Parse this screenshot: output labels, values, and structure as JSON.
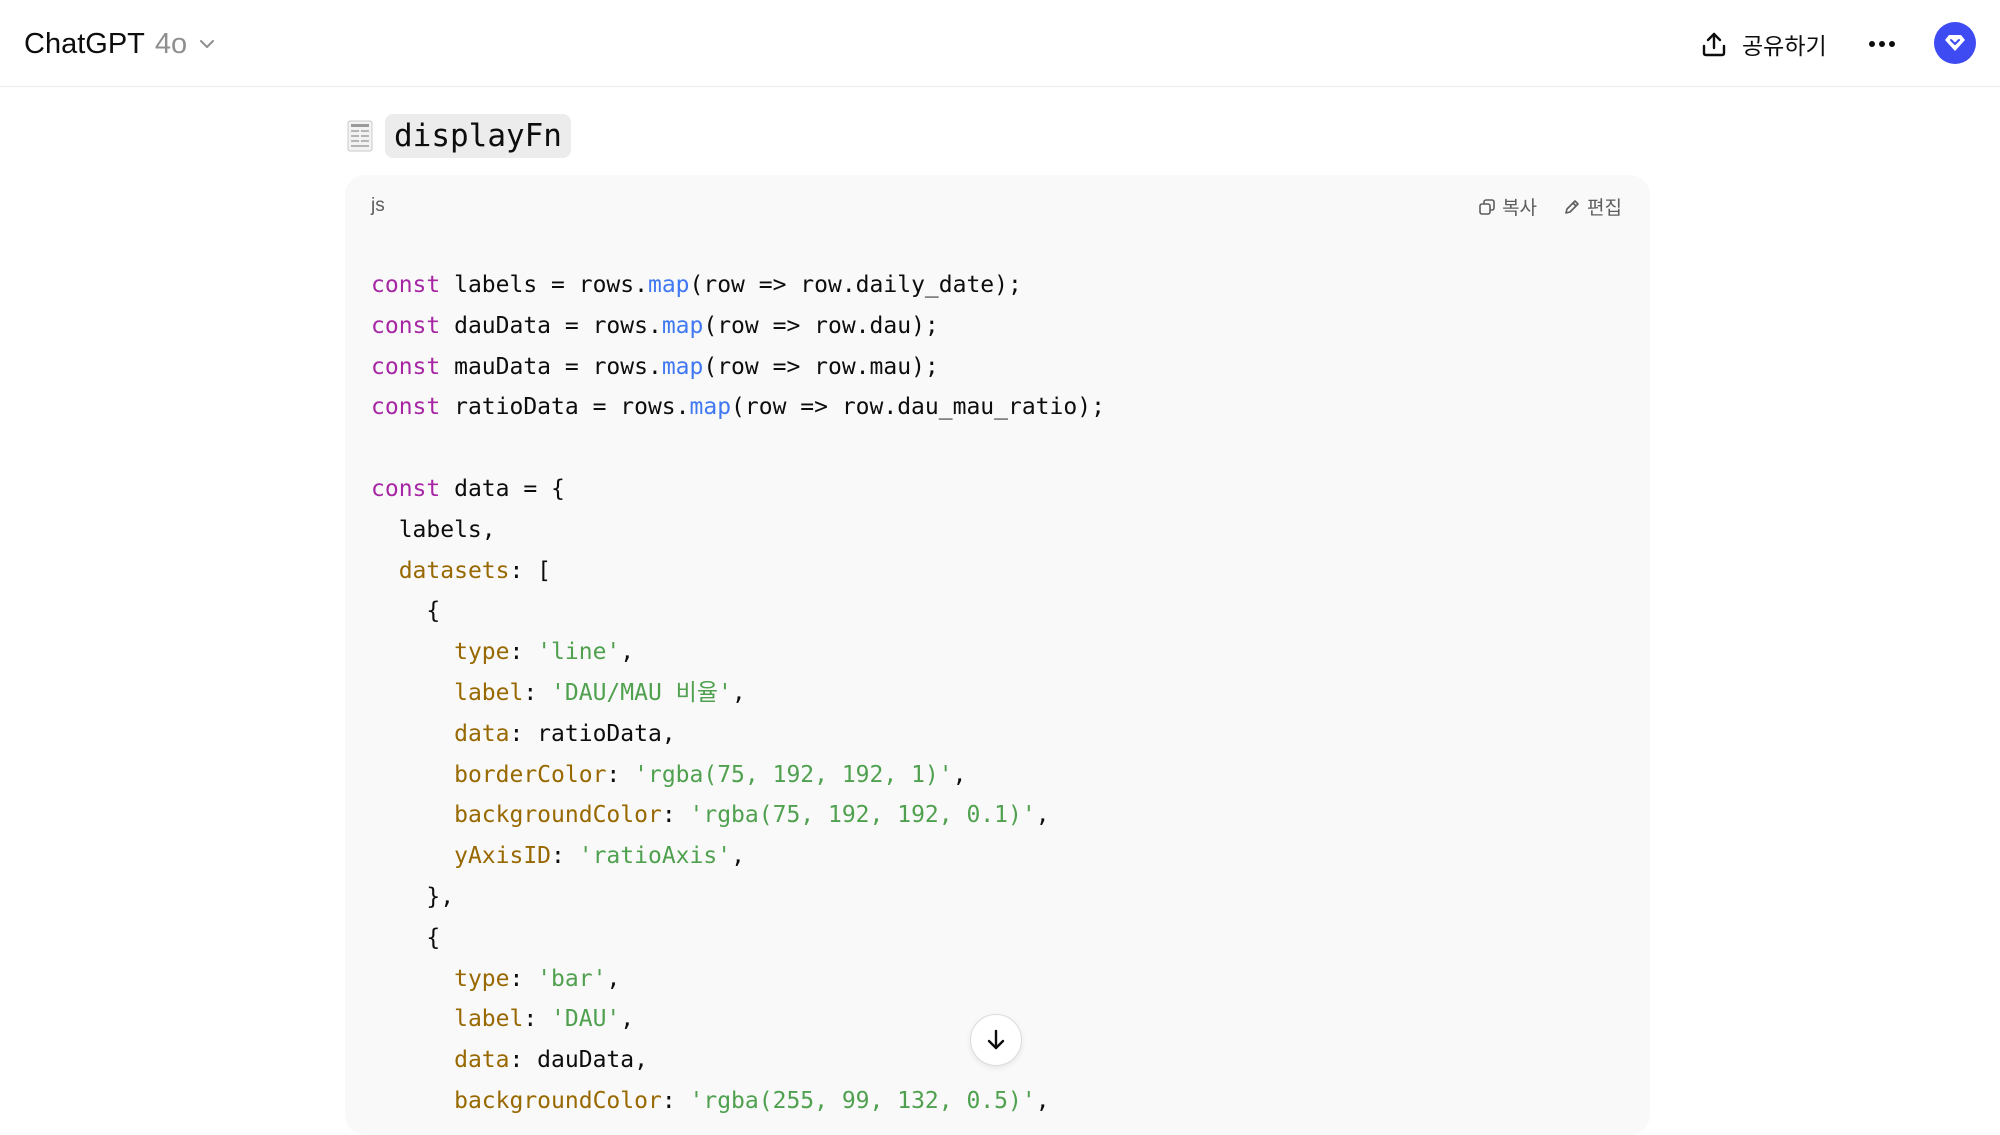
{
  "header": {
    "model_name": "ChatGPT",
    "model_version": "4o",
    "share_label": "공유하기"
  },
  "tool": {
    "name": "displayFn"
  },
  "code_block": {
    "language": "js",
    "copy_label": "복사",
    "edit_label": "편집",
    "lines": [
      "const labels = rows.map(row => row.daily_date);",
      "const dauData = rows.map(row => row.dau);",
      "const mauData = rows.map(row => row.mau);",
      "const ratioData = rows.map(row => row.dau_mau_ratio);",
      "",
      "const data = {",
      "  labels,",
      "  datasets: [",
      "    {",
      "      type: 'line',",
      "      label: 'DAU/MAU 비율',",
      "      data: ratioData,",
      "      borderColor: 'rgba(75, 192, 192, 1)',",
      "      backgroundColor: 'rgba(75, 192, 192, 0.1)',",
      "      yAxisID: 'ratioAxis',",
      "    },",
      "    {",
      "      type: 'bar',",
      "      label: 'DAU',",
      "      data: dauData,",
      "      backgroundColor: 'rgba(255, 99, 132, 0.5)',"
    ]
  },
  "colors": {
    "keyword": "#a626a4",
    "function": "#4078f2",
    "property": "#986801",
    "string": "#50a14f",
    "avatar": "#3e4bf2"
  },
  "icons": {
    "share": "share-icon",
    "more": "more-horizontal-icon",
    "avatar": "user-avatar-icon",
    "chevron": "chevron-down-icon",
    "copy": "copy-icon",
    "edit": "edit-icon",
    "scroll": "arrow-down-icon",
    "tool": "document-icon"
  }
}
